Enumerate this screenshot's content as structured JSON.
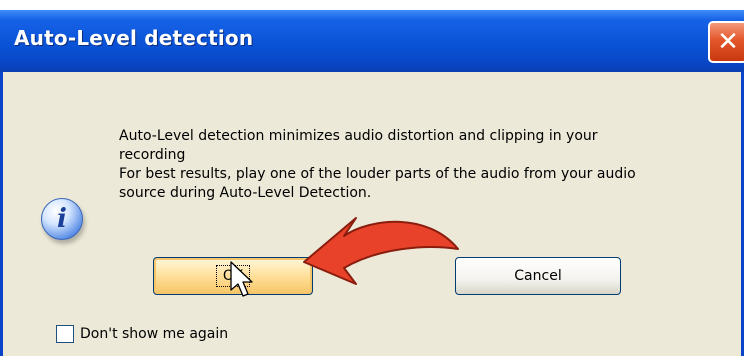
{
  "dialog": {
    "title": "Auto-Level detection",
    "close_glyph": "✕",
    "message_lines": [
      "Auto-Level detection minimizes audio distortion and clipping in your",
      "recording",
      "For best results, play one of the louder parts of the audio from your audio",
      "source during Auto-Level Detection."
    ],
    "ok_label": "OK",
    "cancel_label": "Cancel",
    "checkbox_label": "Don't show me again",
    "checkbox_checked": false
  },
  "icons": {
    "info": "info-icon",
    "close": "close-icon",
    "cursor": "mouse-pointer-icon",
    "annotation": "red-arrow-annotation"
  },
  "colors": {
    "titlebar": "#0a53d7",
    "dialog_background": "#ece9d8",
    "close_button": "#e3562b",
    "arrow": "#e8432a"
  }
}
